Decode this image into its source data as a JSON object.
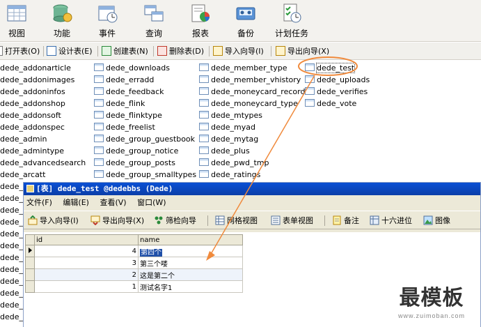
{
  "main_toolbar": {
    "buttons": [
      {
        "label": "视图",
        "icon": "view-icon"
      },
      {
        "label": "功能",
        "icon": "function-icon"
      },
      {
        "label": "事件",
        "icon": "event-icon"
      },
      {
        "label": "查询",
        "icon": "query-icon"
      },
      {
        "label": "报表",
        "icon": "report-icon"
      },
      {
        "label": "备份",
        "icon": "backup-icon"
      },
      {
        "label": "计划任务",
        "icon": "schedule-icon"
      }
    ]
  },
  "sub_toolbar": {
    "open_table": "打开表(O)",
    "design_table": "设计表(E)",
    "create_table": "创建表(N)",
    "delete_table": "删除表(D)",
    "import_wizard": "导入向导(I)",
    "export_wizard": "导出向导(X)"
  },
  "table_list": {
    "col0": [
      "dede_addonarticle",
      "dede_addonimages",
      "dede_addoninfos",
      "dede_addonshop",
      "dede_addonsoft",
      "dede_addonspec",
      "dede_admin",
      "dede_admintype",
      "dede_advancedsearch",
      "dede_arcatt",
      "dede_",
      "dede_",
      "dede_",
      "dede_",
      "dede_",
      "dede_",
      "dede_",
      "dede_",
      "dede_",
      "dede_",
      "dede_",
      "dede_"
    ],
    "col1": [
      "dede_downloads",
      "dede_erradd",
      "dede_feedback",
      "dede_flink",
      "dede_flinktype",
      "dede_freelist",
      "dede_group_guestbook",
      "dede_group_notice",
      "dede_group_posts",
      "dede_group_smalltypes"
    ],
    "col2": [
      "dede_member_type",
      "dede_member_vhistory",
      "dede_moneycard_record",
      "dede_moneycard_type",
      "dede_mtypes",
      "dede_myad",
      "dede_mytag",
      "dede_plus",
      "dede_pwd_tmp",
      "dede_ratings"
    ],
    "col3": [
      "dede_test",
      "dede_uploads",
      "dede_verifies",
      "dede_vote"
    ]
  },
  "table_window": {
    "title": "[表] dede_test @dedebbs (Dede)",
    "menu": [
      "文件(F)",
      "编辑(E)",
      "查看(V)",
      "窗口(W)"
    ],
    "toolbar": {
      "import_wizard": "导入向导(I)",
      "export_wizard": "导出向导(X)",
      "filter_wizard": "筛检向导",
      "grid_view": "网格视图",
      "form_view": "表单视图",
      "memo": "备注",
      "hex": "十六进位",
      "image": "图像"
    },
    "columns": [
      "id",
      "name"
    ],
    "rows": [
      {
        "id": "4",
        "name": "第四个"
      },
      {
        "id": "3",
        "name": "第三个喽"
      },
      {
        "id": "2",
        "name": "这是第二个"
      },
      {
        "id": "1",
        "name": "测试名字1"
      }
    ]
  },
  "watermark": {
    "title": "最模板",
    "url": "www.zuimoban.com"
  },
  "colors": {
    "annotation": "#f08a3c",
    "titlebar": "#0a4fd4",
    "selection": "#1f4fa8"
  }
}
